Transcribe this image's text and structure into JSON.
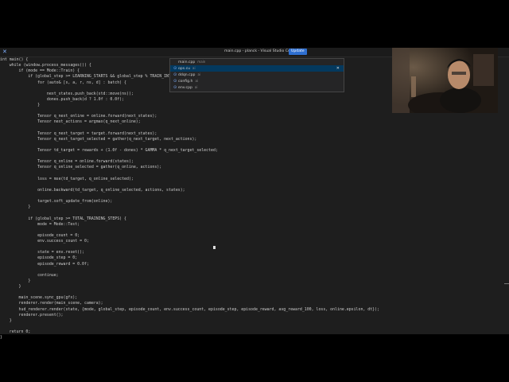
{
  "window": {
    "title": "main.cpp - planck - Visual Studio Code",
    "update_label": "Update"
  },
  "quick_open": {
    "items": [
      {
        "name": "main.cpp",
        "dir": "main"
      },
      {
        "name": "ops.cu",
        "dir": "ai"
      },
      {
        "name": "ddqn.cpp",
        "dir": "ai"
      },
      {
        "name": "config.h",
        "dir": "ai"
      },
      {
        "name": "env.cpp",
        "dir": "ai"
      }
    ]
  },
  "editor": {
    "lines": [
      "int main() {",
      "    while (window.process_messages()) {",
      "        if (mode == Mode::Train) {",
      "            if (global_step >= LEARNING_STARTS && global_step % TRAIN_INTERVAL == 0) {",
      "                for (auto& [s, a, r, ns, d] : batch) {",
      "",
      "                    next_states.push_back(std::move(ns));",
      "                    dones.push_back(d ? 1.0f : 0.0f);",
      "                }",
      "",
      "                Tensor q_next_online = online.forward(next_states);",
      "                Tensor next_actions = argmax(q_next_online);",
      "",
      "                Tensor q_next_target = target.forward(next_states);",
      "                Tensor q_next_target_selected = gather(q_next_target, next_actions);",
      "",
      "                Tensor td_target = rewards + (1.0f - dones) * GAMMA * q_next_target_selected;",
      "",
      "                Tensor q_online = online.forward(states);",
      "                Tensor q_online_selected = gather(q_online, actions);",
      "",
      "                loss = mse(td_target, q_online_selected);",
      "",
      "                online.backward(td_target, q_online_selected, actions, states);",
      "",
      "                target.soft_update_from(online);",
      "            }",
      "",
      "            if (global_step >= TOTAL_TRAINING_STEPS) {",
      "                mode = Mode::Test;",
      "",
      "                episode_count = 0;",
      "                env.success_count = 0;",
      "",
      "                state = env.reset();",
      "                episode_step = 0;",
      "                episode_reward = 0.0f;",
      "",
      "                continue;",
      "            }",
      "        }",
      "",
      "        main_scene.sync_gpu(gfx);",
      "        renderer.render(main_scene, camera);",
      "        hud_renderer.render(state, {mode, global_step, episode_count, env.success_count, episode_step, episode_reward, avg_reward_100, loss, online.epsilon, dt});",
      "        renderer.present();",
      "    }",
      "",
      "    return 0;",
      "}"
    ]
  }
}
